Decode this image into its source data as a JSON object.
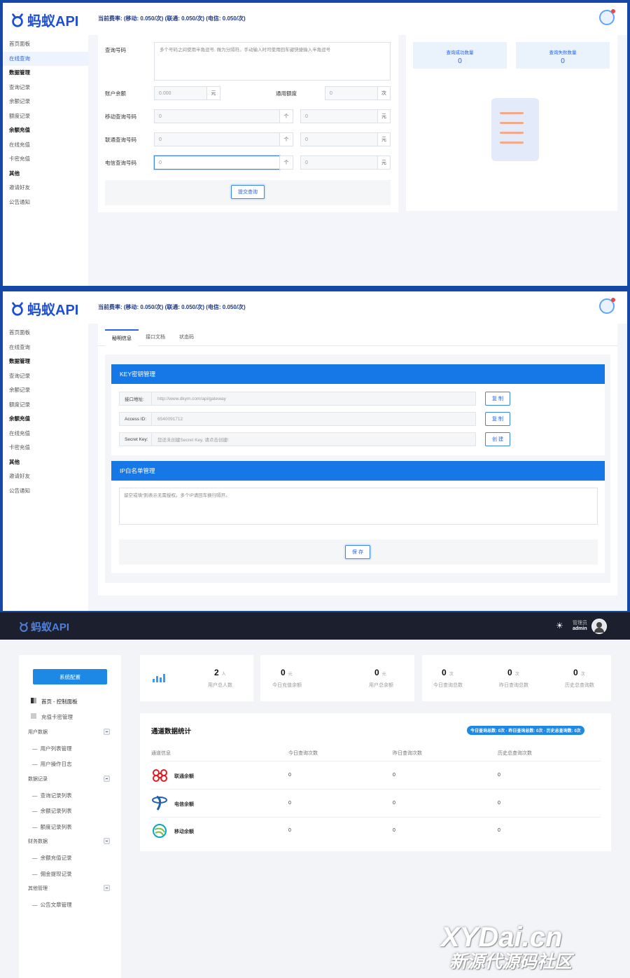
{
  "app": {
    "logo_text": "蚂蚁API"
  },
  "header": {
    "rate_text": "当前费率:    (移动: 0.050/次)    (联通: 0.050/次)    (电信: 0.050/次)"
  },
  "sidebar": {
    "items": [
      "首页面板",
      "在线查询"
    ],
    "groups": [
      {
        "title": "数据管理",
        "items": [
          "查询记录",
          "余额记录",
          "额度记录"
        ]
      },
      {
        "title": "余额充值",
        "items": [
          "在线充值",
          "卡密充值"
        ]
      },
      {
        "title": "其他",
        "items": [
          "邀请好友",
          "公告通知"
        ]
      }
    ]
  },
  "query": {
    "number_label": "查询号码",
    "number_placeholder": "多个号码之间使用半角逗号, 做为分隔符。手动输入时可使用回车键快捷输入半角逗号",
    "balance_label": "账户余额",
    "balance_value": "0.000",
    "balance_unit": "元",
    "quota_label": "通用额度",
    "quota_value": "0",
    "quota_unit": "次",
    "mobile_label": "移动查询号码",
    "unicom_label": "联通查询号码",
    "telecom_label": "电信查询号码",
    "count_value": "0",
    "arrow": "个",
    "yuan_value": "0",
    "yuan_unit": "元",
    "submit": "提交查询",
    "success_label": "查询成功数量",
    "success_value": "0",
    "fail_label": "查询失败数量",
    "fail_value": "0"
  },
  "keys": {
    "tabs": [
      "秘明信息",
      "接口文档",
      "状态码"
    ],
    "section_key": "KEY密钥管理",
    "rows": [
      {
        "k": "接口地址:",
        "v": "http://www.dkym.com/api/gateway",
        "btn": "复 制"
      },
      {
        "k": "Access ID:",
        "v": "6540091712",
        "btn": "复 制"
      },
      {
        "k": "Secret Key:",
        "v": "您还未创建Secret Key, 请点击创建!",
        "btn": "创 建"
      }
    ],
    "section_ip": "IP白名单管理",
    "ip_placeholder": "留空或填*则表示无需授权。多个IP请回车换行隔开。",
    "save": "保 存"
  },
  "admin": {
    "logo_text": "蚂蚁API",
    "role": "管理员",
    "user": "admin",
    "config_button": "系统配置",
    "menu_top": [
      "首页 - 控制面板",
      "充值卡密管理"
    ],
    "menu_groups": [
      {
        "title": "用户数据",
        "items": [
          "用户列表管理",
          "用户操作日志"
        ]
      },
      {
        "title": "数据记录",
        "items": [
          "查询记录列表",
          "余额记录列表",
          "额度记录列表"
        ]
      },
      {
        "title": "财务数据",
        "items": [
          "余额充值记录",
          "佣金提现记录"
        ]
      },
      {
        "title": "其他管理",
        "items": [
          "公告文章管理"
        ]
      }
    ],
    "stats": [
      {
        "num": "2",
        "unit": "人",
        "label": "用户总人数"
      },
      {
        "num": "0",
        "unit": "元",
        "label": "今日充值余额"
      },
      {
        "num": "0",
        "unit": "元",
        "label": "用户总余额"
      },
      {
        "num": "0",
        "unit": "次",
        "label": "今日查询总数"
      },
      {
        "num": "0",
        "unit": "次",
        "label": "昨日查询总数"
      },
      {
        "num": "0",
        "unit": "次",
        "label": "历史总查询数"
      }
    ],
    "channel_title": "通道数据统计",
    "channel_badge": "今日查询总数: 0次 · 昨日查询总数: 0次 · 历史总查询数: 0次",
    "table_headers": [
      "通道信息",
      "今日查询次数",
      "昨日查询次数",
      "历史总查询次数"
    ],
    "rows": [
      {
        "name": "联通余额",
        "today": "0",
        "yesterday": "0",
        "total": "0"
      },
      {
        "name": "电信余额",
        "today": "0",
        "yesterday": "0",
        "total": "0"
      },
      {
        "name": "移动余额",
        "today": "0",
        "yesterday": "0",
        "total": "0"
      }
    ]
  },
  "watermark": {
    "line1": "XYDai.cn",
    "line2": "新源代源码社区"
  },
  "colors": {
    "primary": "#2563eb",
    "bar": "#1677e6",
    "dark": "#1c1f2e"
  }
}
